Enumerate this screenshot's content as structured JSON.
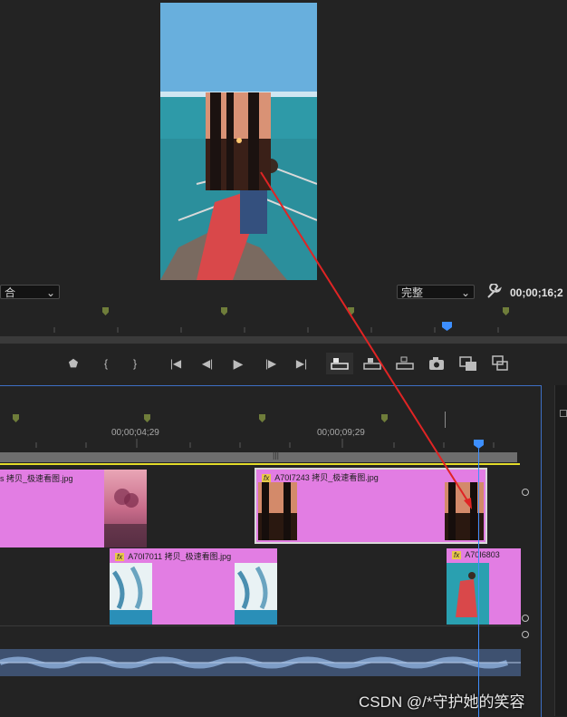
{
  "monitor": {
    "fit_partial": "合",
    "quality": "完整",
    "timecode": "00;00;16;2"
  },
  "timeline": {
    "ruler_labels": [
      "00;00;04;29",
      "00;00;09;29"
    ],
    "tracks": {
      "v2": [
        {
          "label": "s 拷贝_极速看图.jpg"
        },
        {
          "fx": "fx",
          "label": "A70I7243 拷贝_极速看图.jpg"
        }
      ],
      "v1": [
        {
          "fx": "fx",
          "label": "A70I7011 拷贝_极速看图.jpg"
        },
        {
          "fx": "fx",
          "label": "A70I6803"
        }
      ]
    }
  },
  "watermark": "CSDN @/*守护她的笑容",
  "colors": {
    "clip": "#e27de3",
    "playhead": "#3d8fff",
    "annotation": "#e02424",
    "work_area": "#e4dc2a"
  }
}
